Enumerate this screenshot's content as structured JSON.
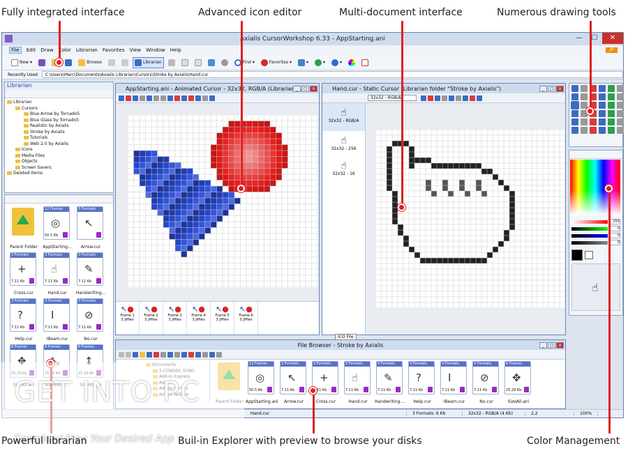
{
  "captions": {
    "top": [
      "Fully integrated interface",
      "Advanced icon editor",
      "Multi-document interface",
      "Numerous drawing tools"
    ],
    "bottom": [
      "Powerful librarian",
      "Buil-in Explorer with preview to browse your disks",
      "Color Management"
    ]
  },
  "window": {
    "title": "Axialis CursorWorkshop 6.33 - AppStarting.ani",
    "menu": [
      "File",
      "Edit",
      "Draw",
      "Color",
      "Librarian",
      "Favorites",
      "View",
      "Window",
      "Help"
    ],
    "toolbar": {
      "new": "New",
      "librarian": "Librarian",
      "browse": "Browse",
      "find": "Find",
      "favorites": "Favorites"
    },
    "recently_used_label": "Recently Used",
    "path": "C:\\Users\\Marc\\Documents\\Axialis Librarian\\Cursors\\Stroke by Axialis\\Hand.cur"
  },
  "librarian": {
    "title": "Librarian",
    "tree": [
      {
        "label": "Librarian",
        "depth": 0
      },
      {
        "label": "Cursors",
        "depth": 1
      },
      {
        "label": "Blue Arrow by Tornado5",
        "depth": 2
      },
      {
        "label": "Blue Glass by Tornado5",
        "depth": 2
      },
      {
        "label": "Realistic by Axialis",
        "depth": 2
      },
      {
        "label": "Stroke by Axialis",
        "depth": 2
      },
      {
        "label": "Tutorials",
        "depth": 2
      },
      {
        "label": "Web 2.0 by Axialis",
        "depth": 2
      },
      {
        "label": "Icons",
        "depth": 1
      },
      {
        "label": "Media Files",
        "depth": 1
      },
      {
        "label": "Objects",
        "depth": 1
      },
      {
        "label": "Screen Savers",
        "depth": 1
      },
      {
        "label": "Deleted Items",
        "depth": 0
      }
    ],
    "items": [
      {
        "name": "Parent Folder",
        "frames": "",
        "size": ""
      },
      {
        "name": "AppStarting...",
        "frames": "12 Frames",
        "size": "50.5 Kb"
      },
      {
        "name": "Arrow.cur",
        "frames": "3 Formats",
        "size": ""
      },
      {
        "name": "Cross.cur",
        "frames": "3 Formats",
        "size": "7.11 Kb"
      },
      {
        "name": "Hand.cur",
        "frames": "3 Formats",
        "size": "7.11 Kb"
      },
      {
        "name": "Handwriting...",
        "frames": "3 Formats",
        "size": "7.11 Kb"
      },
      {
        "name": "Help.cur",
        "frames": "3 Formats",
        "size": "7.11 Kb"
      },
      {
        "name": "IBeam.cur",
        "frames": "3 Formats",
        "size": "7.11 Kb"
      },
      {
        "name": "No.cur",
        "frames": "3 Formats",
        "size": "7.11 Kb"
      },
      {
        "name": "SizeAll.ani",
        "frames": "6 Frames",
        "size": "25.29 Kb"
      },
      {
        "name": "SizeNWSE...",
        "frames": "6 Frames",
        "size": "25.29 Kb"
      },
      {
        "name": "SizeNS.ani",
        "frames": "6 Frames",
        "size": "25.29 Kb"
      }
    ]
  },
  "doc1": {
    "title": "AppStarting.ani - Animated Cursor - 32x32, RGB/A (Librarian ...",
    "frames": [
      {
        "label": "Frame 1",
        "sub": "3 Jiffies"
      },
      {
        "label": "Frame 2",
        "sub": "3 Jiffies"
      },
      {
        "label": "Frame 3",
        "sub": "3 Jiffies"
      },
      {
        "label": "Frame 4",
        "sub": "3 Jiffies"
      },
      {
        "label": "Frame 5",
        "sub": "3 Jiffies"
      },
      {
        "label": "Frame 6",
        "sub": "3 Jiffies"
      }
    ]
  },
  "doc2": {
    "title": "Hand.cur - Static Cursor (Librarian folder \"Stroke by Axialis\")",
    "format_select": "32x32 - RGB/A",
    "formats": [
      "32x32 - RGB/A",
      "32x32 - 256",
      "32x32 - 16"
    ]
  },
  "browser": {
    "title": "File Browser - Stroke by Axialis",
    "tooltip": "ICO File",
    "tree": [
      "Documents",
      "5-CONSEIL SYND",
      "Add-in Express",
      "Adobe",
      "Adobe Scripts",
      "Airbus William"
    ],
    "items": [
      {
        "name": "Parent Folder",
        "frames": "",
        "size": ""
      },
      {
        "name": "AppStarting.ani",
        "frames": "12 Frames",
        "size": "50.5 Kb"
      },
      {
        "name": "Arrow.cur",
        "frames": "3 Formats",
        "size": "7.11 Kb"
      },
      {
        "name": "Cross.cur",
        "frames": "3 Formats",
        "size": "7.11 Kb"
      },
      {
        "name": "Hand.cur",
        "frames": "3 Formats",
        "size": "7.11 Kb"
      },
      {
        "name": "Handwriting....",
        "frames": "3 Formats",
        "size": "7.11 Kb"
      },
      {
        "name": "Help.cur",
        "frames": "3 Formats",
        "size": "7.11 Kb"
      },
      {
        "name": "IBeam.cur",
        "frames": "3 Formats",
        "size": "7.11 Kb"
      },
      {
        "name": "No.cur",
        "frames": "3 Formats",
        "size": "7.11 Kb"
      },
      {
        "name": "SizeAll.ani",
        "frames": "6 Frames",
        "size": "25.29 Kb"
      }
    ]
  },
  "status": {
    "file": "Hand.cur",
    "formats": "3 Formats: 6 Kb",
    "format": "32x32 - RGB/A (4 Kb)",
    "coords": "2,2",
    "zoom": "100%"
  },
  "color": {
    "values": [
      "255",
      "0",
      "0",
      "0"
    ]
  },
  "watermark": {
    "main": "GET INTO PC",
    "sub": "Download Free Your Desired App"
  },
  "colors": {
    "accent_line": "#e02020",
    "title_bg": "#cfdcee",
    "badge": "#9a2ac0"
  }
}
